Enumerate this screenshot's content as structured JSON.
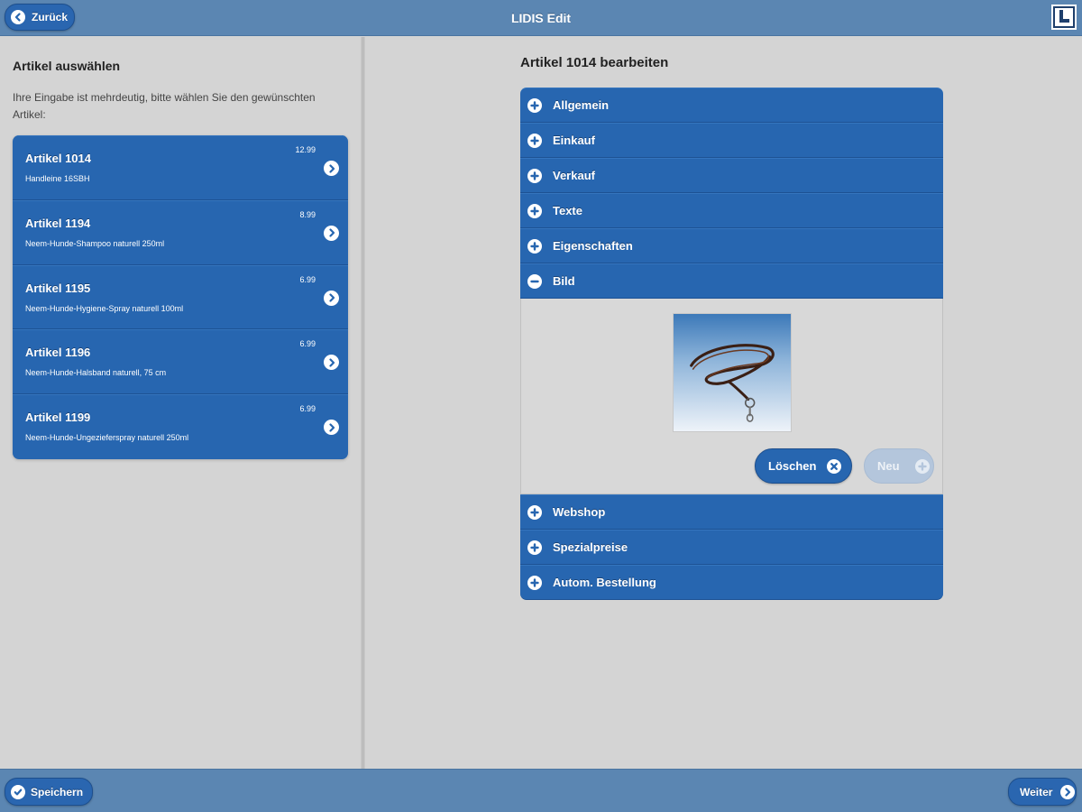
{
  "header": {
    "back_label": "Zurück",
    "title": "LIDIS Edit",
    "logo_icon": "lidis-logo"
  },
  "left": {
    "title": "Artikel auswählen",
    "description": "Ihre Eingabe ist mehrdeutig, bitte wählen Sie den gewünschten Artikel:",
    "articles": [
      {
        "name": "Artikel 1014",
        "desc": "Handleine 16SBH",
        "price": "12.99"
      },
      {
        "name": "Artikel 1194",
        "desc": "Neem-Hunde-Shampoo naturell 250ml",
        "price": "8.99"
      },
      {
        "name": "Artikel 1195",
        "desc": "Neem-Hunde-Hygiene-Spray naturell 100ml",
        "price": "6.99"
      },
      {
        "name": "Artikel 1196",
        "desc": "Neem-Hunde-Halsband naturell, 75 cm",
        "price": "6.99"
      },
      {
        "name": "Artikel 1199",
        "desc": "Neem-Hunde-Ungezieferspray naturell 250ml",
        "price": "6.99"
      }
    ]
  },
  "right": {
    "title": "Artikel 1014 bearbeiten",
    "sections": [
      {
        "label": "Allgemein",
        "icon": "plus-icon"
      },
      {
        "label": "Einkauf",
        "icon": "plus-icon"
      },
      {
        "label": "Verkauf",
        "icon": "plus-icon"
      },
      {
        "label": "Texte",
        "icon": "plus-icon"
      },
      {
        "label": "Eigenschaften",
        "icon": "plus-icon"
      },
      {
        "label": "Bild",
        "icon": "minus-icon"
      },
      {
        "label": "Webshop",
        "icon": "plus-icon"
      },
      {
        "label": "Spezialpreise",
        "icon": "plus-icon"
      },
      {
        "label": "Autom. Bestellung",
        "icon": "plus-icon"
      }
    ],
    "image_section": {
      "delete_label": "Löschen",
      "new_label": "Neu"
    }
  },
  "footer": {
    "save_label": "Speichern",
    "next_label": "Weiter"
  },
  "colors": {
    "bar": "#5b86b2",
    "primary": "#2766b0",
    "background": "#d4d4d4"
  }
}
